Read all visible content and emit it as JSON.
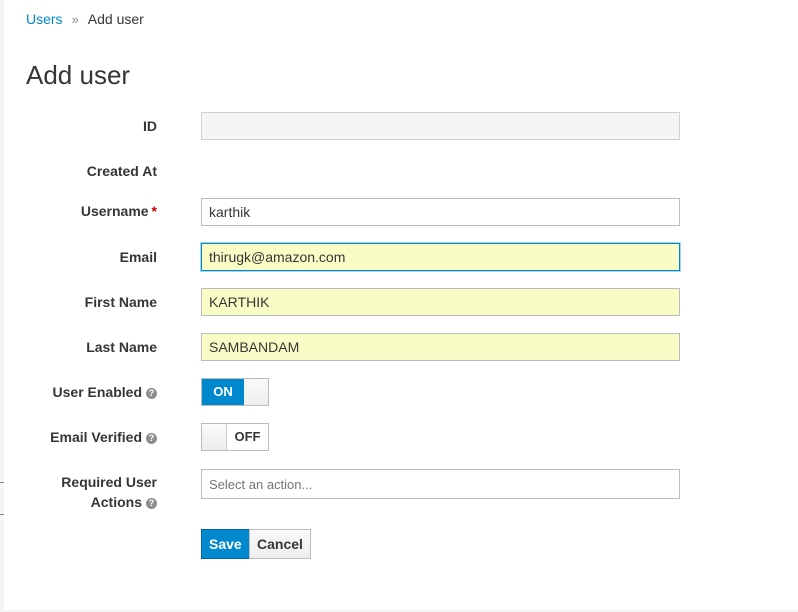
{
  "breadcrumb": {
    "parent": "Users",
    "separator": "»",
    "current": "Add user"
  },
  "page_title": "Add user",
  "form": {
    "id": {
      "label": "ID",
      "value": ""
    },
    "created_at": {
      "label": "Created At",
      "value": ""
    },
    "username": {
      "label": "Username",
      "required_mark": "*",
      "value": "karthik"
    },
    "email": {
      "label": "Email",
      "value": "thirugk@amazon.com"
    },
    "first_name": {
      "label": "First Name",
      "value": "KARTHIK"
    },
    "last_name": {
      "label": "Last Name",
      "value": "SAMBANDAM"
    },
    "user_enabled": {
      "label": "User Enabled",
      "state": "ON",
      "help_icon": "question-circle-icon"
    },
    "email_verified": {
      "label": "Email Verified",
      "state": "OFF",
      "help_icon": "question-circle-icon"
    },
    "required_actions": {
      "label_line1": "Required User",
      "label_line2": "Actions",
      "placeholder": "Select an action...",
      "help_icon": "question-circle-icon"
    }
  },
  "buttons": {
    "save": "Save",
    "cancel": "Cancel"
  },
  "colors": {
    "primary": "#0088ce",
    "autofill": "#fafcc6",
    "required": "#cc0000"
  }
}
